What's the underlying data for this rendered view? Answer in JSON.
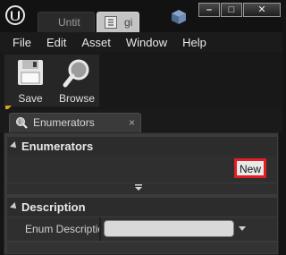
{
  "window": {
    "tabs": [
      {
        "label": "Untit"
      },
      {
        "label": "gi"
      }
    ],
    "buttons": {
      "minimize": "–",
      "maximize": "□",
      "close": "✕"
    }
  },
  "menu": {
    "items": [
      "File",
      "Edit",
      "Asset",
      "Window",
      "Help"
    ]
  },
  "toolbar": {
    "save_label": "Save",
    "browse_label": "Browse"
  },
  "panel_tab": {
    "label": "Enumerators",
    "close": "×"
  },
  "sections": {
    "enumerators_title": "Enumerators",
    "new_button": "New",
    "description_title": "Description",
    "enum_description_label": "Enum Descriptio",
    "enum_description_value": ""
  },
  "colors": {
    "highlight": "#e01e24",
    "accent": "#d8a420"
  }
}
